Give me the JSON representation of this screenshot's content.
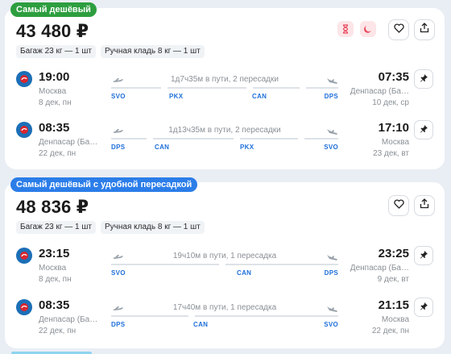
{
  "colors": {
    "accent": "#2d9e3f",
    "blue": "#1e6fd9",
    "badge_blue": "#2b7de9",
    "alert_red": "#e8485b"
  },
  "offers": [
    {
      "badge": "Самый дешёвый",
      "price": "43 480 ₽",
      "tags": [
        "Багаж 23 кг — 1 шт",
        "Ручная кладь 8 кг — 1 шт"
      ],
      "segments": [
        {
          "dep_time": "19:00",
          "dep_city": "Москва",
          "dep_date": "8 дек, пн",
          "duration": "1д7ч35м в пути, 2 пересадки",
          "arr_time": "07:35",
          "arr_city": "Денпасар (Ба…",
          "arr_date": "10 дек, ср",
          "codes": [
            "SVO",
            "PKX",
            "CAN",
            "DPS"
          ]
        },
        {
          "dep_time": "08:35",
          "dep_city": "Денпасар (Ба…",
          "dep_date": "22 дек, пн",
          "duration": "1д13ч35м в пути, 2 пересадки",
          "arr_time": "17:10",
          "arr_city": "Москва",
          "arr_date": "23 дек, вт",
          "codes": [
            "DPS",
            "CAN",
            "PKX",
            "SVO"
          ]
        }
      ]
    },
    {
      "badge": "Самый дешёвый с удобной пересадкой",
      "price": "48 836 ₽",
      "tags": [
        "Багаж 23 кг — 1 шт",
        "Ручная кладь 8 кг — 1 шт"
      ],
      "segments": [
        {
          "dep_time": "23:15",
          "dep_city": "Москва",
          "dep_date": "8 дек, пн",
          "duration": "19ч10м в пути, 1 пересадка",
          "arr_time": "23:25",
          "arr_city": "Денпасар (Ба…",
          "arr_date": "9 дек, вт",
          "codes": [
            "SVO",
            "CAN",
            "DPS"
          ]
        },
        {
          "dep_time": "08:35",
          "dep_city": "Денпасар (Ба…",
          "dep_date": "22 дек, пн",
          "duration": "17ч40м в пути, 1 пересадка",
          "arr_time": "21:15",
          "arr_city": "Москва",
          "arr_date": "22 дек, пн",
          "codes": [
            "DPS",
            "CAN",
            "SVO"
          ]
        }
      ]
    }
  ],
  "icons": {
    "favorite": "heart-icon",
    "share": "share-icon",
    "pin": "pin-icon",
    "hourglass": "hourglass-icon",
    "night": "moon-icon",
    "airline": "airline-logo",
    "takeoff": "takeoff-icon",
    "landing": "landing-icon"
  }
}
